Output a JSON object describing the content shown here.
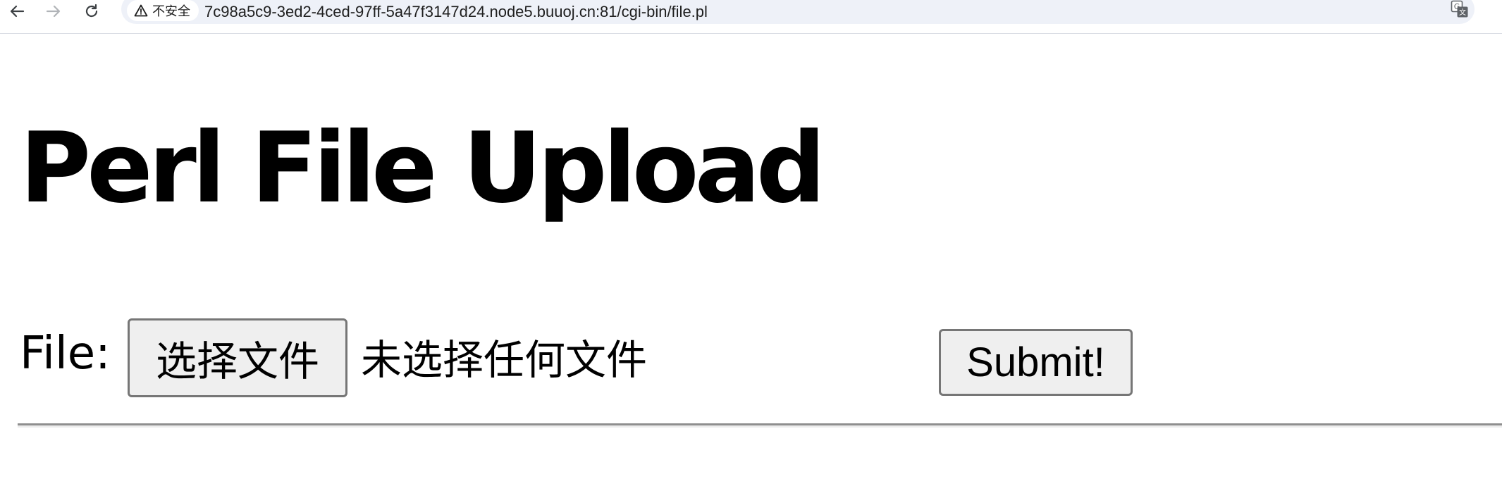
{
  "browser": {
    "security_label": "不安全",
    "url": "7c98a5c9-3ed2-4ced-97ff-5a47f3147d24.node5.buuoj.cn:81/cgi-bin/file.pl",
    "icons": {
      "back": "back-arrow-icon",
      "forward": "forward-arrow-icon",
      "reload": "reload-icon",
      "warning": "warning-triangle-icon",
      "translate": "translate-icon"
    }
  },
  "page": {
    "title": "Perl File Upload",
    "form": {
      "file_label": "File:",
      "choose_button_label": "选择文件",
      "no_file_text": "未选择任何文件",
      "submit_label": "Submit!"
    }
  },
  "colors": {
    "omnibox_bg": "#eef1f8",
    "button_bg": "#efefef",
    "button_border": "#767676",
    "divider": "#8f8f8f"
  }
}
